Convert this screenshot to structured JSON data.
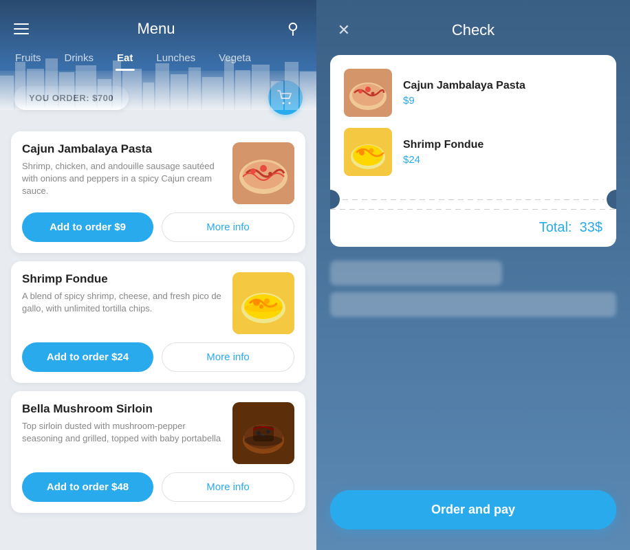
{
  "left": {
    "header": {
      "title": "Menu",
      "hamburger_label": "hamburger",
      "search_label": "search"
    },
    "tabs": [
      {
        "id": "fruits",
        "label": "Fruits",
        "active": false
      },
      {
        "id": "drinks",
        "label": "Drinks",
        "active": false
      },
      {
        "id": "eat",
        "label": "Eat",
        "active": true
      },
      {
        "id": "lunches",
        "label": "Lunches",
        "active": false
      },
      {
        "id": "vegeta",
        "label": "Vegeta",
        "active": false
      }
    ],
    "order_bar": {
      "label": "YOU ORDER: $700",
      "cart_icon": "🛒"
    },
    "menu_items": [
      {
        "id": "cajun",
        "name": "Cajun Jambalaya Pasta",
        "description": "Shrimp, chicken, and andouille sausage sautéed with onions and peppers in a spicy Cajun cream sauce.",
        "add_label": "Add to order  $9",
        "more_label": "More info",
        "image_type": "pasta"
      },
      {
        "id": "shrimp",
        "name": "Shrimp Fondue",
        "description": "A blend of spicy shrimp, cheese, and fresh pico de gallo, with unlimited tortilla chips.",
        "add_label": "Add to order  $24",
        "more_label": "More info",
        "image_type": "fondue"
      },
      {
        "id": "sirloin",
        "name": "Bella Mushroom Sirloin",
        "description": "Top sirloin dusted with mushroom-pepper seasoning and grilled, topped with baby portabella",
        "add_label": "Add to order  $48",
        "more_label": "More info",
        "image_type": "sirloin"
      }
    ]
  },
  "right": {
    "header": {
      "title": "Check",
      "close_label": "✕"
    },
    "receipt_items": [
      {
        "id": "cajun",
        "name": "Cajun Jambalaya Pasta",
        "price": "$9",
        "image_type": "pasta"
      },
      {
        "id": "shrimp",
        "name": "Shrimp Fondue",
        "price": "$24",
        "image_type": "fondue"
      }
    ],
    "total_label": "Total:",
    "total_value": "33$",
    "order_pay_label": "Order and pay"
  }
}
